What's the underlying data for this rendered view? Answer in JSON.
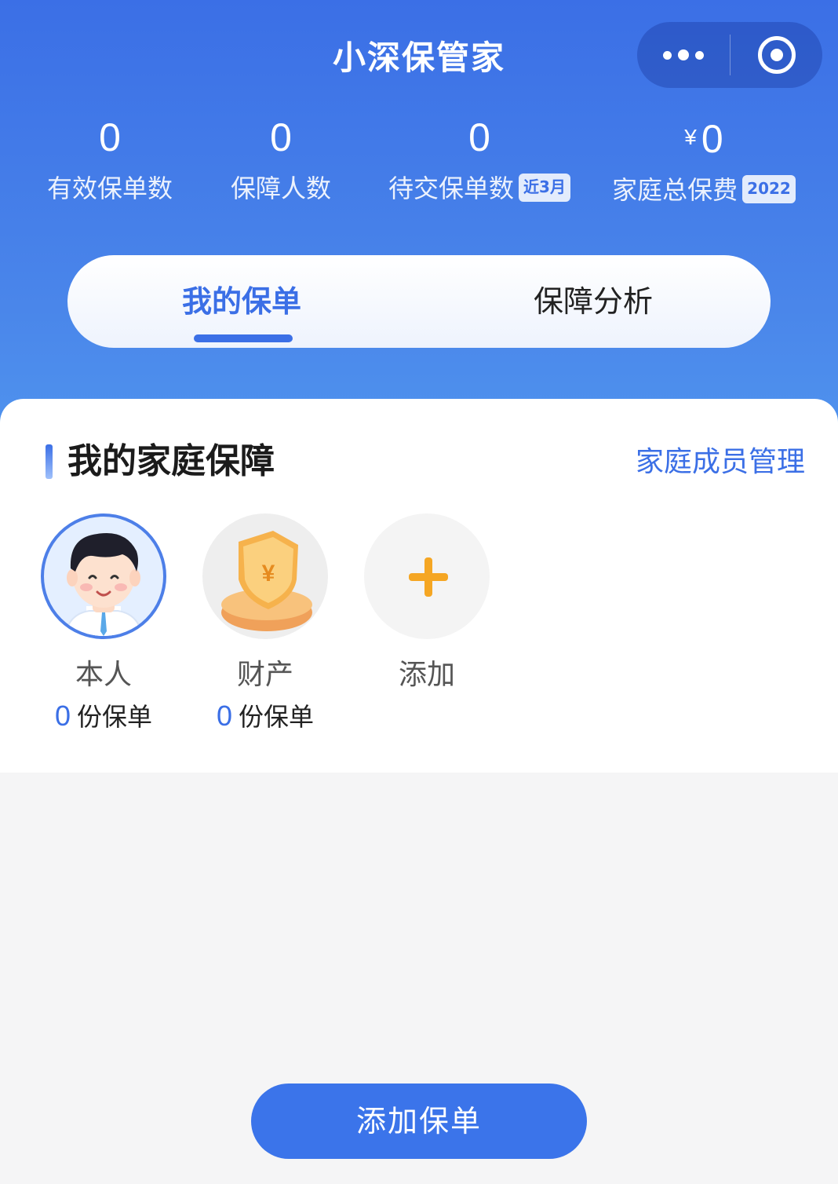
{
  "app": {
    "title": "小深保管家"
  },
  "stats": [
    {
      "value": "0",
      "label": "有效保单数"
    },
    {
      "value": "0",
      "label": "保障人数"
    },
    {
      "value": "0",
      "label": "待交保单数",
      "tag": "近3月"
    },
    {
      "currency": "¥",
      "value": "0",
      "label": "家庭总保费",
      "tag": "2022"
    }
  ],
  "tabs": [
    {
      "label": "我的保单",
      "active": true
    },
    {
      "label": "保障分析",
      "active": false
    }
  ],
  "section": {
    "title": "我的家庭保障",
    "link": "家庭成员管理"
  },
  "members": [
    {
      "name": "本人",
      "count": "0",
      "unit": "份保单",
      "icon": "person-avatar-icon"
    },
    {
      "name": "财产",
      "count": "0",
      "unit": "份保单",
      "icon": "shield-coin-icon"
    },
    {
      "name": "添加",
      "icon": "plus-icon"
    }
  ],
  "footer": {
    "add_policy_label": "添加保单"
  },
  "colors": {
    "primary": "#3b6fe6",
    "accent_orange": "#f5a623"
  }
}
